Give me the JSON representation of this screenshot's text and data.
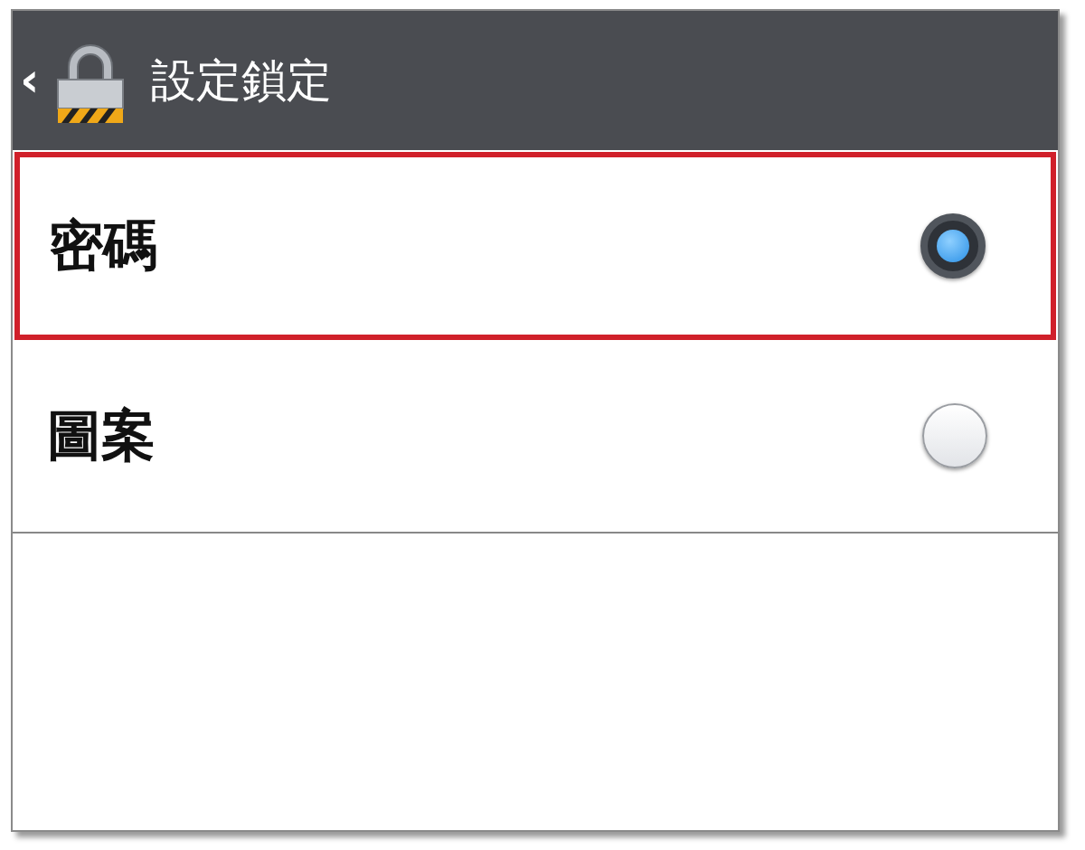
{
  "header": {
    "back": "‹",
    "title": "設定鎖定"
  },
  "options": [
    {
      "label": "密碼",
      "selected": true,
      "highlighted": true
    },
    {
      "label": "圖案",
      "selected": false,
      "highlighted": false
    }
  ]
}
